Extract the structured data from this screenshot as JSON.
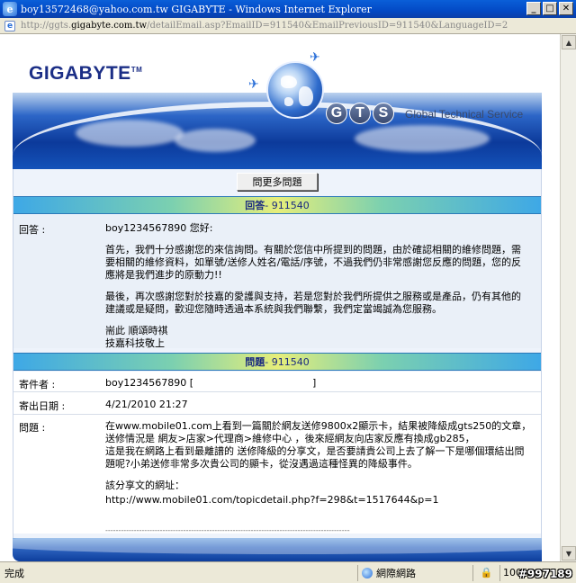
{
  "window": {
    "title": "boy13572468@yahoo.com.tw GIGABYTE - Windows Internet Explorer",
    "url_prefix": "http://ggts.",
    "url_host": "gigabyte.com.tw",
    "url_path": "/detailEmail.asp?EmailID=911540&EmailPreviousID=911540&LanguageID=2"
  },
  "header": {
    "logo": "GIGABYTE",
    "logo_tm": "TM",
    "gts_letters": [
      "G",
      "T",
      "S"
    ],
    "tagline": "Global Technical Service"
  },
  "toolbar": {
    "more_questions_label": "問更多問題"
  },
  "reply_section": {
    "title": "回答",
    "id_text": " - 911540",
    "label": "回答 :",
    "greeting": "boy1234567890 您好:",
    "paragraph1": "首先，我們十分感謝您的來信詢問。有關於您信中所提到的問題，由於確認相關的維修問題，需要相關的維修資料，如單號/送修人姓名/電話/序號，不過我們仍非常感謝您反應的問題，您的反應將是我們進步的原動力!!",
    "paragraph2": "最後，再次感謝您對於技嘉的愛護與支持，若是您對於我們所提供之服務或是產品，仍有其他的建議或是疑問，歡迎您隨時透過本系統與我們聯繫，我們定當竭誠為您服務。",
    "closing1": "耑此 順頌時祺",
    "closing2": "技嘉科技敬上"
  },
  "question_section": {
    "title": "問題",
    "id_text": " - 911540",
    "sender_label": "寄件者 :",
    "sender_value": "boy1234567890 [",
    "sender_close": "]",
    "date_label": "寄出日期 :",
    "date_value": "4/21/2010 21:27",
    "question_label": "問題 :",
    "question_line1": "在www.mobile01.com上看到一篇關於網友送修9800x2顯示卡，結果被降級成gts250的文章，送修情況是 網友>店家>代理商>維修中心 ，後來經網友向店家反應有換成gb285，",
    "question_line2": "這是我在網路上看到最離譜的 送修降級的分享文，是否要請貴公司上去了解一下是哪個環結出問題呢?小弟送修非常多次貴公司的顯卡，從沒遇過這種怪異的降級事件。",
    "share_label": "該分享文的網址：",
    "share_url": "http://www.mobile01.com/topicdetail.php?f=298&t=1517644&p=1",
    "dashes": "------------------------------------------------------------------------------------------------"
  },
  "statusbar": {
    "status_text": "完成",
    "zone_text": "網際網路",
    "zoom_text": "100%",
    "watermark": "#997189"
  },
  "colors": {
    "titlebar": "#0349c5",
    "section_text": "#1a2a80",
    "logo": "#1b2e86",
    "chrome": "#ece9d8"
  }
}
